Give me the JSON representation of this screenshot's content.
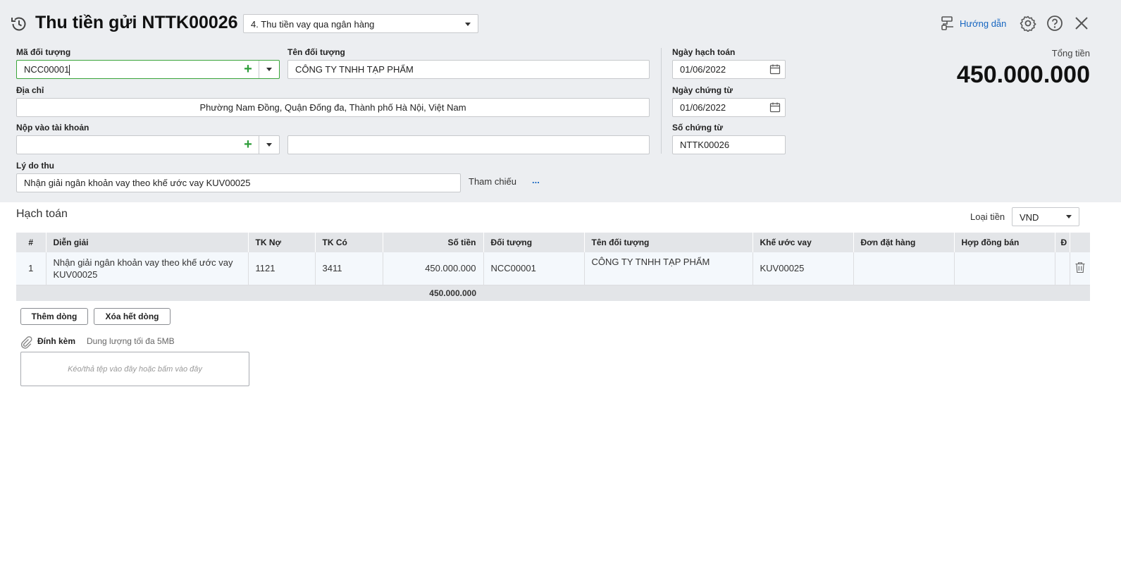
{
  "header": {
    "title": "Thu tiền gửi NTTK00026",
    "voucher_type": "4. Thu tiền vay qua ngân hàng",
    "guide_label": "Hướng dẫn"
  },
  "form": {
    "object_code_label": "Mã đối tượng",
    "object_code_value": "NCC00001",
    "object_name_label": "Tên đối tượng",
    "object_name_value": "CÔNG TY TNHH TẠP PHẨM",
    "address_label": "Địa chỉ",
    "address_value": "Phường Nam Đồng, Quận Đống đa, Thành phố Hà Nội, Việt Nam",
    "account_label": "Nộp vào tài khoản",
    "account_value": "",
    "account_name_value": "",
    "reason_label": "Lý do thu",
    "reason_value": "Nhận giải ngân khoản vay theo khế ước vay KUV00025",
    "reference_label": "Tham chiếu",
    "reference_more": "...",
    "posting_date_label": "Ngày hạch toán",
    "posting_date_value": "01/06/2022",
    "voucher_date_label": "Ngày chứng từ",
    "voucher_date_value": "01/06/2022",
    "voucher_no_label": "Số chứng từ",
    "voucher_no_value": "NTTK00026",
    "total_label": "Tổng tiền",
    "total_value": "450.000.000"
  },
  "accounting": {
    "section_title": "Hạch toán",
    "currency_label": "Loại tiền",
    "currency_value": "VND",
    "columns": [
      "#",
      "Diễn giải",
      "TK Nợ",
      "TK Có",
      "Số tiền",
      "Đối tượng",
      "Tên đối tượng",
      "Khế ước vay",
      "Đơn đặt hàng",
      "Hợp đồng bán",
      "Đ"
    ],
    "rows": [
      {
        "index": "1",
        "description_line1": "Nhận giải ngân khoản vay theo khế ước vay",
        "description_line2": "KUV00025",
        "debit": "1121",
        "credit": "3411",
        "amount": "450.000.000",
        "object": "NCC00001",
        "object_name": "CÔNG TY TNHH TẠP PHẨM",
        "loan_contract": "KUV00025",
        "order": "",
        "sales_contract": ""
      }
    ],
    "total_amount": "450.000.000",
    "add_row_label": "Thêm dòng",
    "delete_all_label": "Xóa hết dòng"
  },
  "attachment": {
    "label": "Đính kèm",
    "hint": "Dung lượng tối đa 5MB",
    "drop_text": "Kéo/thả tệp vào đây hoặc bấm vào đây"
  },
  "icons": [
    "history-icon",
    "dropdown-caret-icon",
    "guide-icon",
    "settings-icon",
    "help-icon",
    "close-icon",
    "add-icon",
    "calendar-icon",
    "trash-icon",
    "paperclip-icon"
  ],
  "colors": {
    "header_bg": "#eceef1",
    "accent_green": "#2e9e3a",
    "link_blue": "#1565c0",
    "table_header": "#e3e5e8"
  }
}
